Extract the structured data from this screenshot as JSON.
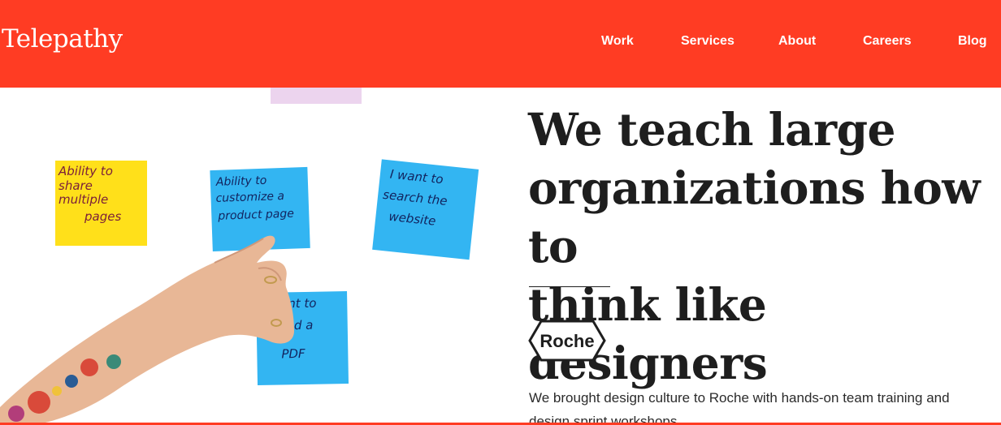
{
  "header": {
    "logo": "Telepathy",
    "nav": [
      "Work",
      "Services",
      "About",
      "Careers",
      "Blog"
    ]
  },
  "hero": {
    "headline_lines": [
      "We teach large",
      "organizations how to",
      "think like designers"
    ],
    "client_logo": "Roche",
    "description": "We brought design culture to Roche with hands-on team training and design sprint workshops."
  },
  "image": {
    "notes": [
      {
        "color": "#ffe01a",
        "lines": [
          "Ability to",
          "share",
          "multiple",
          "pages"
        ]
      },
      {
        "color": "#33b5f2",
        "lines": [
          "Ability to",
          "customize a",
          "product page"
        ]
      },
      {
        "color": "#33b5f2",
        "lines": [
          "I want to",
          "search the",
          "website"
        ]
      },
      {
        "color": "#33b5f2",
        "lines": [
          "nt to",
          "ad a",
          "PDF"
        ]
      }
    ]
  },
  "colors": {
    "brand": "#ff3c23",
    "text": "#1e1e1e"
  }
}
